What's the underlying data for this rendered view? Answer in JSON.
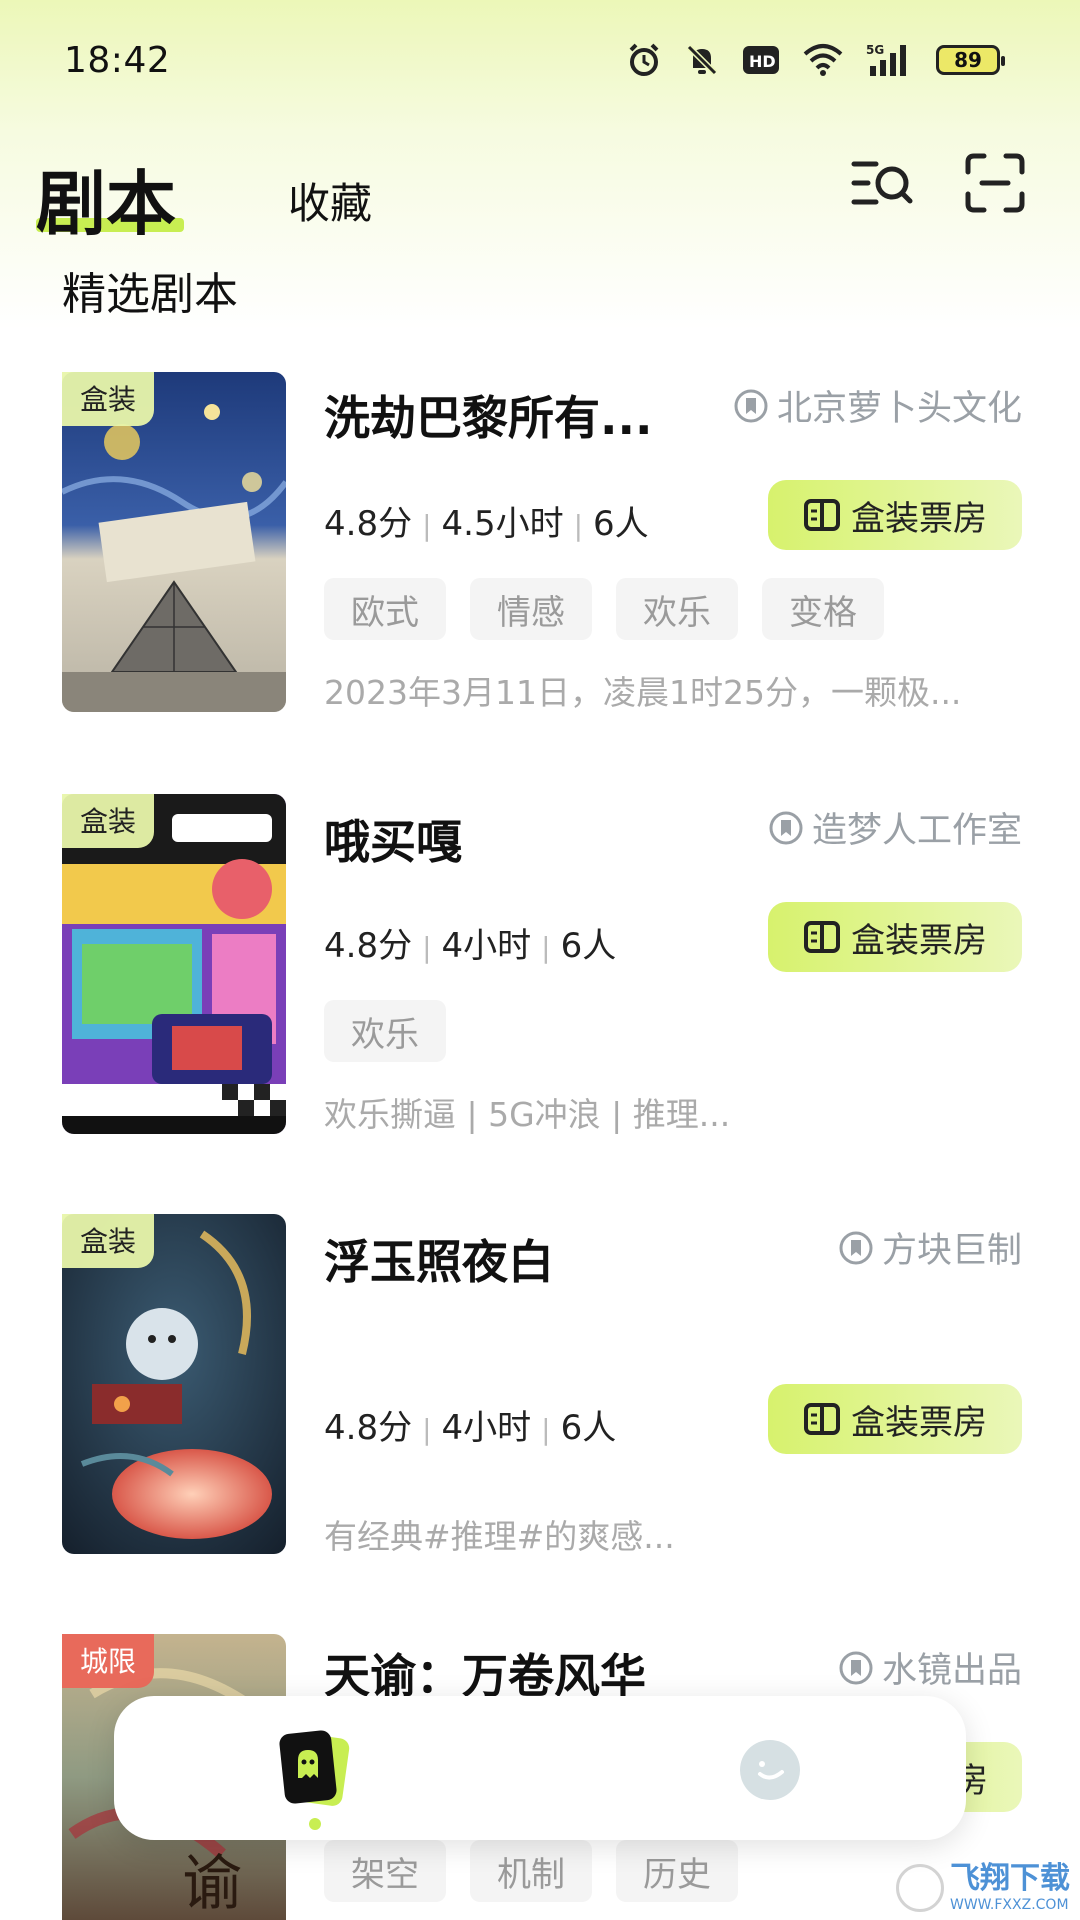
{
  "status_bar": {
    "time": "18:42",
    "network": "5G",
    "battery": "89"
  },
  "header": {
    "tab_active": "剧本",
    "tab_inactive": "收藏"
  },
  "section_title": "精选剧本",
  "cards": [
    {
      "badge": "盒装",
      "title": "洗劫巴黎所有...",
      "publisher": "北京萝卜头文化",
      "score": "4.8分",
      "duration": "4.5小时",
      "players": "6人",
      "button": "盒装票房",
      "tags": [
        "欧式",
        "情感",
        "欢乐",
        "变格"
      ],
      "desc": "2023年3月11日，凌晨1时25分，一颗极..."
    },
    {
      "badge": "盒装",
      "title": "哦买嘎",
      "publisher": "造梦人工作室",
      "score": "4.8分",
      "duration": "4小时",
      "players": "6人",
      "button": "盒装票房",
      "tags": [
        "欢乐"
      ],
      "desc": "欢乐撕逼 | 5G冲浪 | 推理..."
    },
    {
      "badge": "盒装",
      "title": "浮玉照夜白",
      "publisher": "方块巨制",
      "score": "4.8分",
      "duration": "4小时",
      "players": "6人",
      "button": "盒装票房",
      "tags": [],
      "desc": "有经典#推理#的爽感..."
    },
    {
      "badge": "城限",
      "title": "天谕：万卷风华",
      "publisher": "水镜出品",
      "button_partial": "房",
      "tags": [
        "架空",
        "机制",
        "历史"
      ]
    }
  ],
  "bottom_nav": {
    "home_icon": "ghost-card-icon",
    "profile_icon": "smiley-icon"
  },
  "watermark": {
    "main": "飞翔下载",
    "sub": "WWW.FXXZ.COM"
  },
  "colors": {
    "accent": "#c8ee52",
    "button_gradient_start": "#d7f26d",
    "tag_bg": "#f4f4f4",
    "muted_text": "#9aa0a6",
    "badge_red": "#e86a5b"
  }
}
